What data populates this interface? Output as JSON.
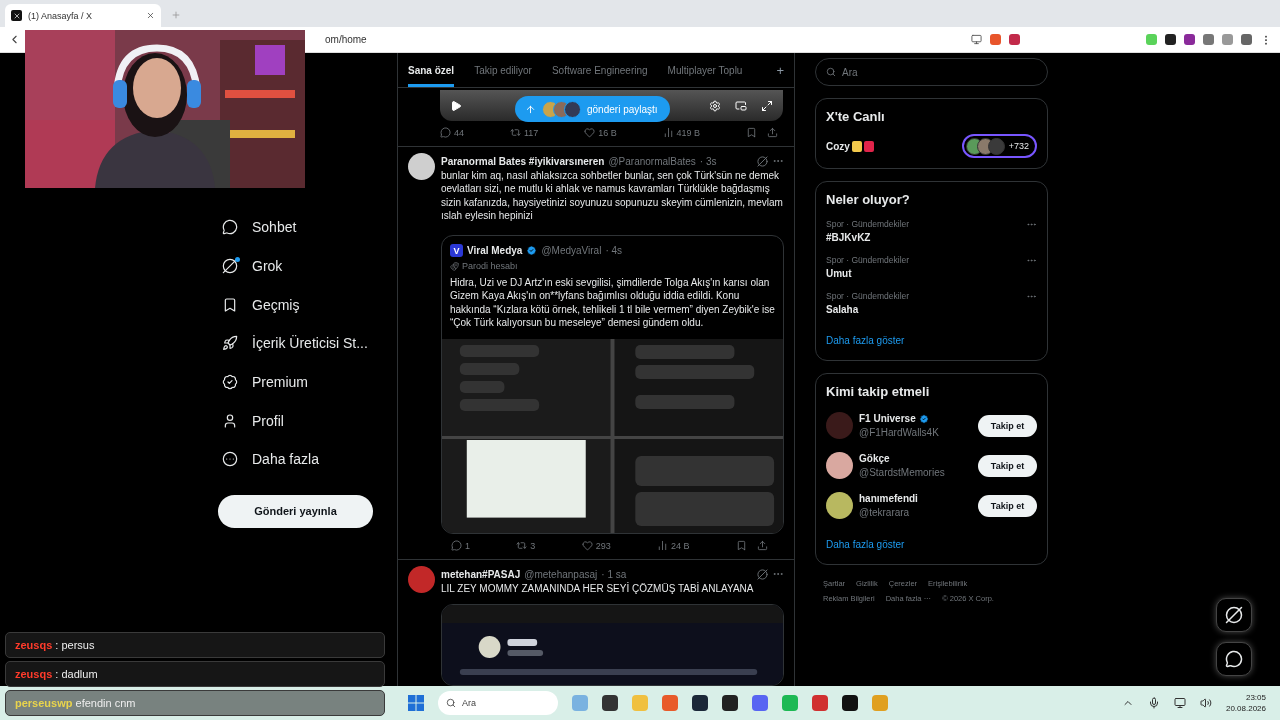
{
  "browser": {
    "tab_title": "(1) Anasayfa / X",
    "url": "om/home"
  },
  "nav": {
    "items": [
      {
        "kind": "chat",
        "label": "Sohbet",
        "unread": false
      },
      {
        "kind": "grok",
        "label": "Grok",
        "unread": true
      },
      {
        "kind": "bookmark",
        "label": "Geçmiş",
        "unread": false
      },
      {
        "kind": "rocket",
        "label": "İçerik Üreticisi St...",
        "unread": false
      },
      {
        "kind": "premium",
        "label": "Premium",
        "unread": false
      },
      {
        "kind": "profile",
        "label": "Profil",
        "unread": false
      },
      {
        "kind": "more",
        "label": "Daha fazla",
        "unread": false
      }
    ],
    "post_button": "Gönderi yayınla"
  },
  "feed": {
    "tabs": [
      {
        "label": "Sana özel",
        "selected": true
      },
      {
        "label": "Takip ediliyor",
        "selected": false
      },
      {
        "label": "Software Engineering",
        "selected": false
      },
      {
        "label": "Multiplayer Toplu",
        "selected": false
      }
    ],
    "add_tab": "+",
    "video_post": {
      "share_pill": "gönderi paylaştı",
      "stats": {
        "replies": "44",
        "reposts": "117",
        "likes": "16 B",
        "views": "419 B"
      }
    },
    "posts": [
      {
        "name": "Paranormal Bates #iyikivarsıneren",
        "handle": "@ParanormalBates",
        "time": "· 3s",
        "text": "bunlar kim aq, nasıl ahlaksızca sohbetler bunlar, sen çok Türk'sün ne demek oevlatları sizi, ne mutlu ki ahlak ve namus kavramları Türklükle bağdaşmış sizin kafanızda, haysiyetinizi soyunuzu sopunuzu skeyim cümlenizin, mevlam ıslah eylesin hepinizi",
        "quote": {
          "logo_letter": "V",
          "name": "Viral Medya",
          "verified": true,
          "handle": "@MedyaViral",
          "time": "· 4s",
          "label": "Parodi hesabı",
          "text": "Hidra, Uzi ve DJ Artz'ın eski sevgilisi, şimdilerde Tolga Akış'ın karısı olan Gizem Kaya Akış'ın on**lyfans bağımlısı olduğu iddia edildi. Konu hakkında “Kızlara kötü örnek, tehlikeli 1 tl bile vermem” diyen Zeybik'e ise “Çok Türk kalıyorsun bu meseleye” demesi gündem oldu."
        },
        "stats": {
          "replies": "1",
          "reposts": "3",
          "likes": "293",
          "views": "24 B"
        }
      },
      {
        "name": "metehan#PASAJ",
        "handle": "@metehanpasaj",
        "time": "· 1 sa",
        "text": "LIL ZEY MOMMY ZAMANINDA HER SEYİ ÇÖZMÜŞ TABİ ANLAYANA"
      }
    ]
  },
  "sidebar": {
    "search": {
      "placeholder": "Ara"
    },
    "live": {
      "title": "X'te Canlı",
      "space": "Cozy",
      "badges": [
        {
          "color": "#f2c94c"
        },
        {
          "color": "#e0244a"
        }
      ],
      "count": "+732"
    },
    "trends": {
      "title": "Neler oluyor?",
      "items": [
        {
          "category": "Spor · Gündemdekiler",
          "name": "#BJKvKZ"
        },
        {
          "category": "Spor · Gündemdekiler",
          "name": "Umut"
        },
        {
          "category": "Spor · Gündemdekiler",
          "name": "Salaha"
        }
      ],
      "more": "Daha fazla göster"
    },
    "follow": {
      "title": "Kimi takip etmeli",
      "items": [
        {
          "name": "F1 Universe",
          "handle": "@F1HardWalls4K",
          "verified": true,
          "button": "Takip et"
        },
        {
          "name": "Gökçe",
          "handle": "@StardstMemories",
          "verified": false,
          "button": "Takip et"
        },
        {
          "name": "hanımefendi",
          "handle": "@tekrarara",
          "verified": false,
          "button": "Takip et"
        }
      ],
      "more": "Daha fazla göster"
    },
    "footer": {
      "links": [
        "Şartlar",
        "Gizlilik",
        "Çerezler",
        "Erişilebilirlik",
        "Reklam Bilgileri",
        "Daha fazla ···"
      ],
      "copyright": "© 2026 X Corp."
    }
  },
  "chat_overlay": [
    {
      "user": "zeusqs",
      "color": "#ff3b2b",
      "message": ": persus"
    },
    {
      "user": "zeusqs",
      "color": "#ff3b2b",
      "message": ": dadlum"
    },
    {
      "user": "perseuswp",
      "color": "#e9d44c",
      "message": "efendin cnm"
    }
  ],
  "taskbar": {
    "search": "Ara",
    "time": "23:05",
    "date": "20.08.2026"
  }
}
